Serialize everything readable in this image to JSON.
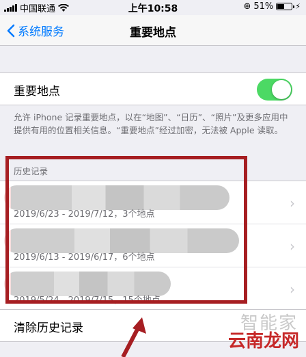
{
  "status_bar": {
    "carrier": "中国联通",
    "time": "上午10:58",
    "battery": "51%",
    "battery_level": 0.51
  },
  "nav": {
    "back_label": "系统服务",
    "title": "重要地点"
  },
  "significant_locations": {
    "label": "重要地点",
    "enabled": true,
    "description": "允许 iPhone 记录重要地点，以在“地图”、“日历”、“照片”及更多应用中提供有用的位置相关信息。“重要地点”经过加密，无法被 Apple 读取。"
  },
  "history": {
    "header": "历史记录",
    "rows": [
      {
        "subtitle": "2019/6/23 - 2019/7/12，3个地点"
      },
      {
        "subtitle": "2019/6/13 - 2019/6/17，6个地点"
      },
      {
        "subtitle": "2019/5/24 - 2019/7/15，15个地点"
      }
    ]
  },
  "clear_history_label": "清除历史记录",
  "watermarks": {
    "brand_gray": "智能家",
    "brand_red": "云南龙网"
  },
  "colors": {
    "accent": "#007aff",
    "switch_on": "#4cd964",
    "highlight": "#a61e22"
  }
}
